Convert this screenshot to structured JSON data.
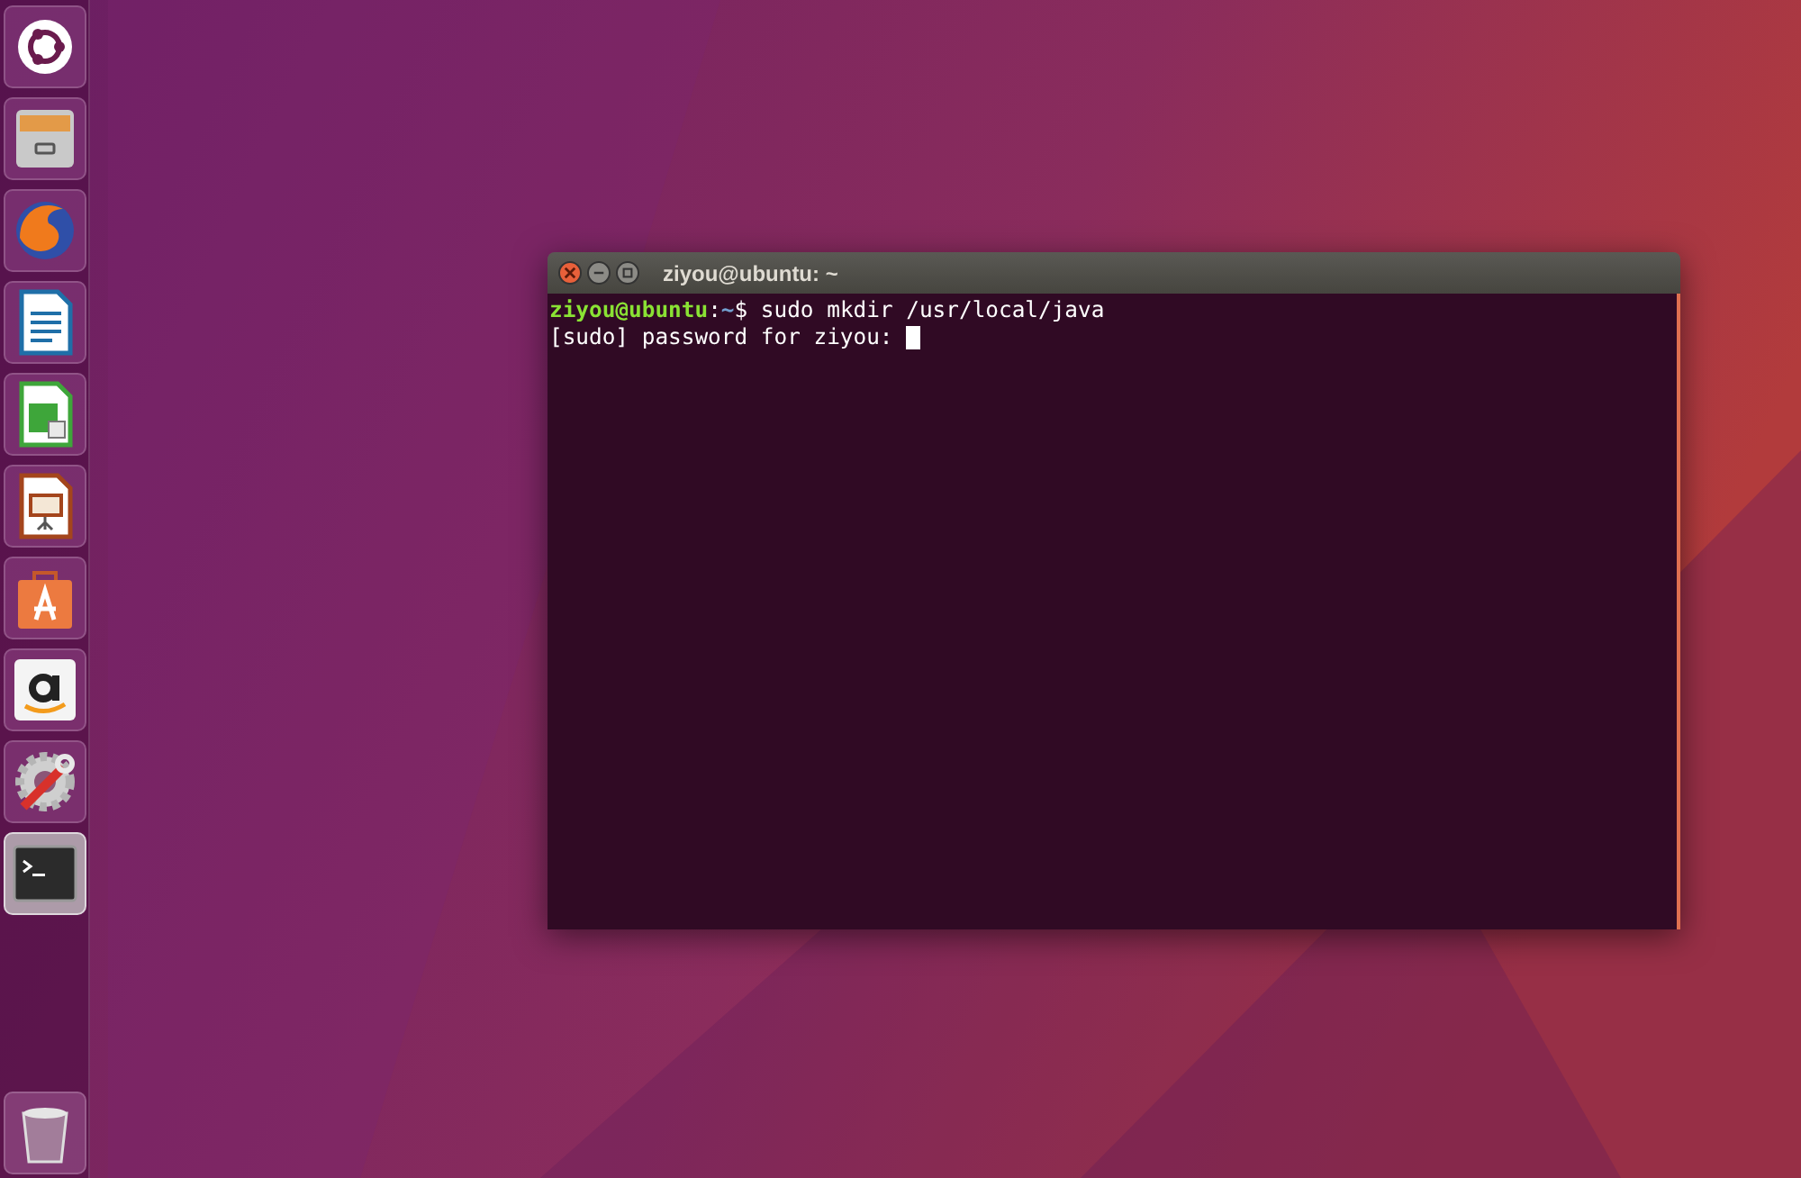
{
  "launcher": {
    "items": [
      {
        "kind": "dash",
        "active": false
      },
      {
        "kind": "files",
        "active": false
      },
      {
        "kind": "browser",
        "active": false
      },
      {
        "kind": "writer",
        "active": false
      },
      {
        "kind": "calc",
        "active": false
      },
      {
        "kind": "impress",
        "active": false
      },
      {
        "kind": "store",
        "active": false
      },
      {
        "kind": "amazon",
        "active": false
      },
      {
        "kind": "settings",
        "active": false
      },
      {
        "kind": "terminal",
        "active": true
      }
    ],
    "trash": {
      "kind": "trash"
    }
  },
  "window": {
    "title": "ziyou@ubuntu: ~",
    "lines": [
      {
        "kind": "prompt",
        "user": "ziyou@ubuntu",
        "separator": ":",
        "path": "~",
        "symbol": "$",
        "command": "sudo mkdir /usr/local/java"
      },
      {
        "kind": "output",
        "text": "[sudo] password for ziyou:",
        "cursor": true
      }
    ]
  }
}
